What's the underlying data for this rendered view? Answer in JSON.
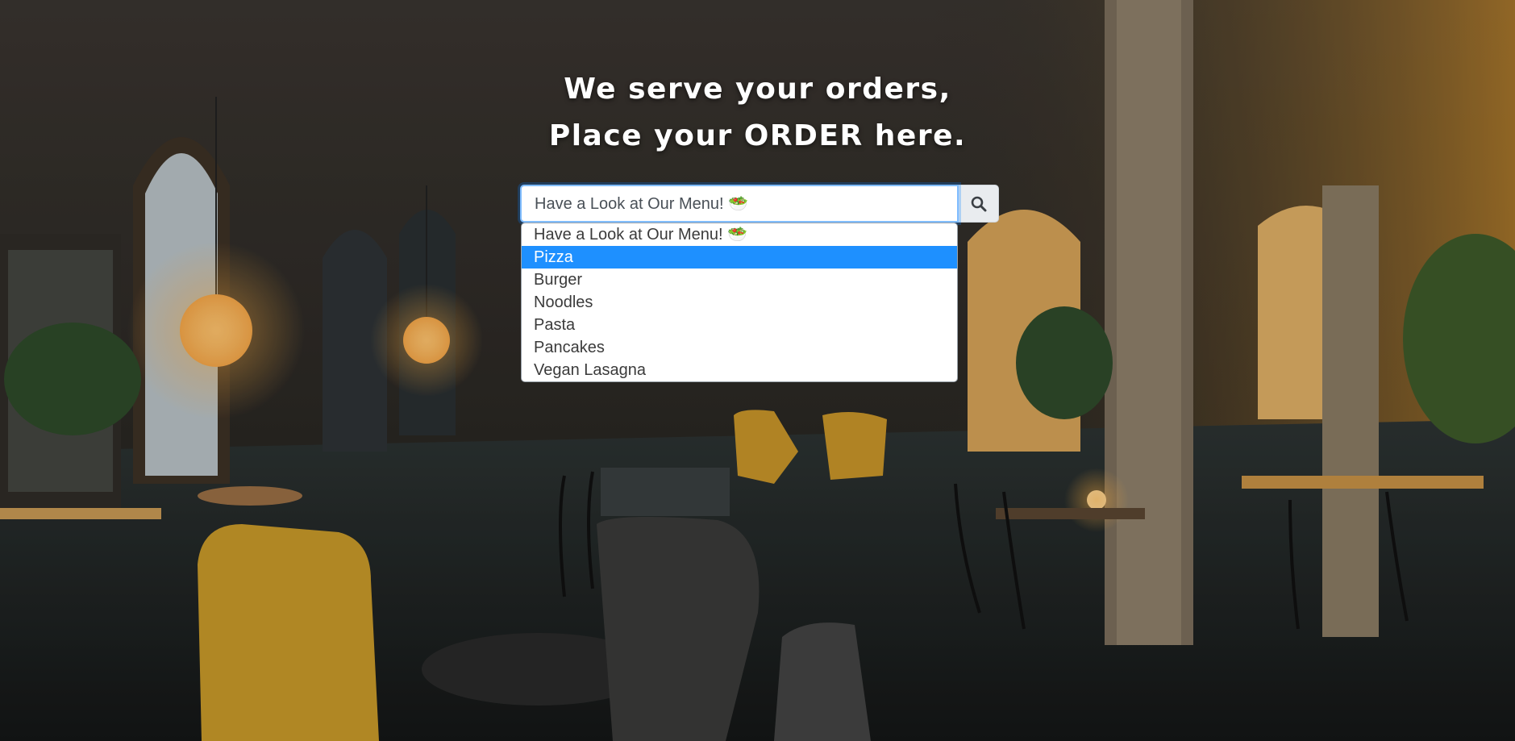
{
  "hero": {
    "title_line1": "We serve your orders,",
    "title_line2": "Place your ORDER here."
  },
  "menu_select": {
    "current_value": "Have a Look at Our Menu! 🥗",
    "selected_index": 1,
    "options": [
      "Have a Look at Our Menu! 🥗",
      "Pizza",
      "Burger",
      "Noodles",
      "Pasta",
      "Pancakes",
      "Vegan Lasagna"
    ]
  },
  "search_button": {
    "icon": "search-icon"
  },
  "colors": {
    "selected_option": "#1e90ff",
    "focus_border": "#80bdff",
    "button_bg": "#e9ecef",
    "heading_text": "#ffffff"
  }
}
